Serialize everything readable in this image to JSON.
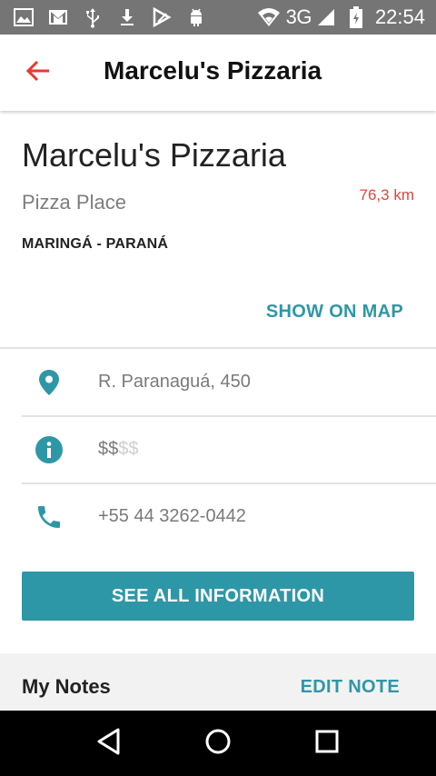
{
  "status_bar": {
    "icons": [
      "image-icon",
      "gmail-icon",
      "usb-icon",
      "download-icon",
      "play-store-icon",
      "android-icon"
    ],
    "network": "3G",
    "time": "22:54"
  },
  "app_bar": {
    "title": "Marcelu's Pizzaria",
    "accent_color": "#e53935"
  },
  "place": {
    "name": "Marcelu's Pizzaria",
    "category": "Pizza Place",
    "distance": "76,3 km",
    "city": "MARINGÁ - PARANÁ",
    "show_on_map": "SHOW ON MAP"
  },
  "info": {
    "address": "R. Paranaguá, 450",
    "price_active": "$$",
    "price_inactive": "$$",
    "phone": "+55 44 3262-0442"
  },
  "actions": {
    "see_all": "SEE ALL INFORMATION"
  },
  "notes": {
    "title": "My Notes",
    "edit": "EDIT NOTE"
  },
  "colors": {
    "primary": "#2e97a7",
    "distance": "#e0463a",
    "status_bar": "#757575"
  }
}
